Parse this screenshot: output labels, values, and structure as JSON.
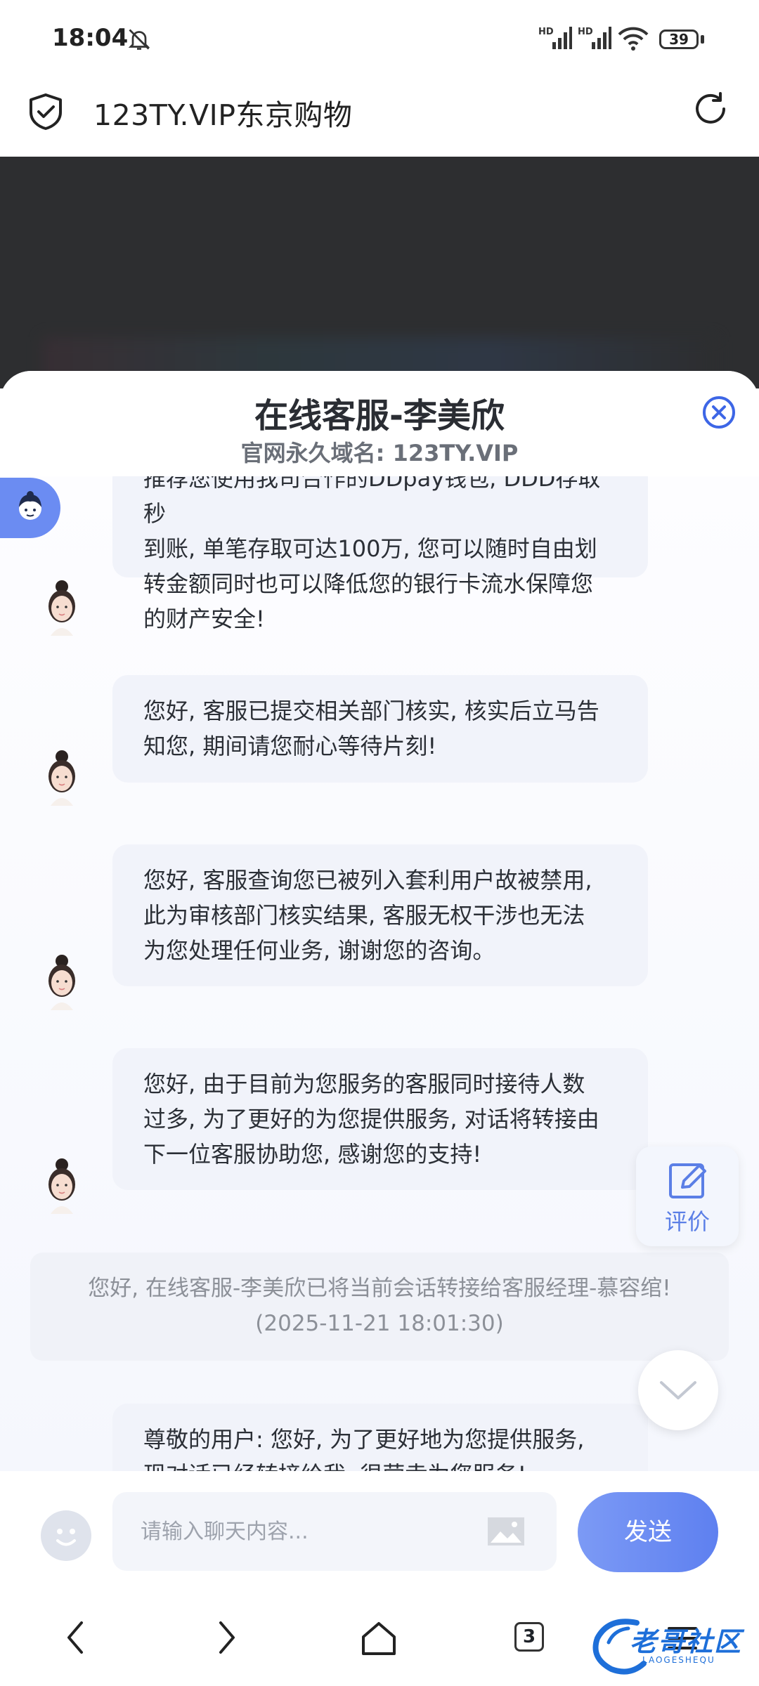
{
  "status_bar": {
    "time": "18:04",
    "hd_label": "HD",
    "battery": "39"
  },
  "browser": {
    "url": "123TY.VIP东京购物"
  },
  "sheet": {
    "title": "在线客服-李美欣",
    "subtitle": "官网永久域名: 123TY.VIP"
  },
  "messages": [
    {
      "lines": [
        "推荐您使用我司合作的DDpay钱包, DDD存取秒",
        "到账, 单笔存取可达100万, 您可以随时自由划",
        "转金额同时也可以降低您的银行卡流水保障您",
        "的财产安全!"
      ]
    },
    {
      "lines": [
        "您好, 客服已提交相关部门核实, 核实后立马告",
        "知您, 期间请您耐心等待片刻!"
      ]
    },
    {
      "lines": [
        "您好, 客服查询您已被列入套利用户故被禁用,",
        "此为审核部门核实结果, 客服无权干涉也无法",
        "为您处理任何业务, 谢谢您的咨询。"
      ]
    },
    {
      "lines": [
        "您好, 由于目前为您服务的客服同时接待人数",
        "过多, 为了更好的为您提供服务, 对话将转接由",
        "下一位客服协助您, 感谢您的支持!"
      ]
    },
    {
      "lines": [
        "尊敬的用户: 您好, 为了更好地为您提供服务,",
        "现对话已经转接给我, 很荣幸为您服务!"
      ]
    }
  ],
  "system_notice": {
    "text": "您好, 在线客服-李美欣已将当前会话转接给客服经理-慕容绾!",
    "time": "(2025-11-21 18:01:30)"
  },
  "evaluate": {
    "label": "评价"
  },
  "input": {
    "placeholder": "请输入聊天内容..."
  },
  "send": {
    "label": "发送"
  },
  "nav": {
    "tab_count": "3"
  },
  "watermark": {
    "text": "老哥社区",
    "sub": "LAOGESHEQU"
  },
  "colors": {
    "accent": "#5e80f0",
    "bubble": "#f1f3fa",
    "sheet_bg": "#ffffff",
    "dim_bg": "#2d2e30"
  }
}
